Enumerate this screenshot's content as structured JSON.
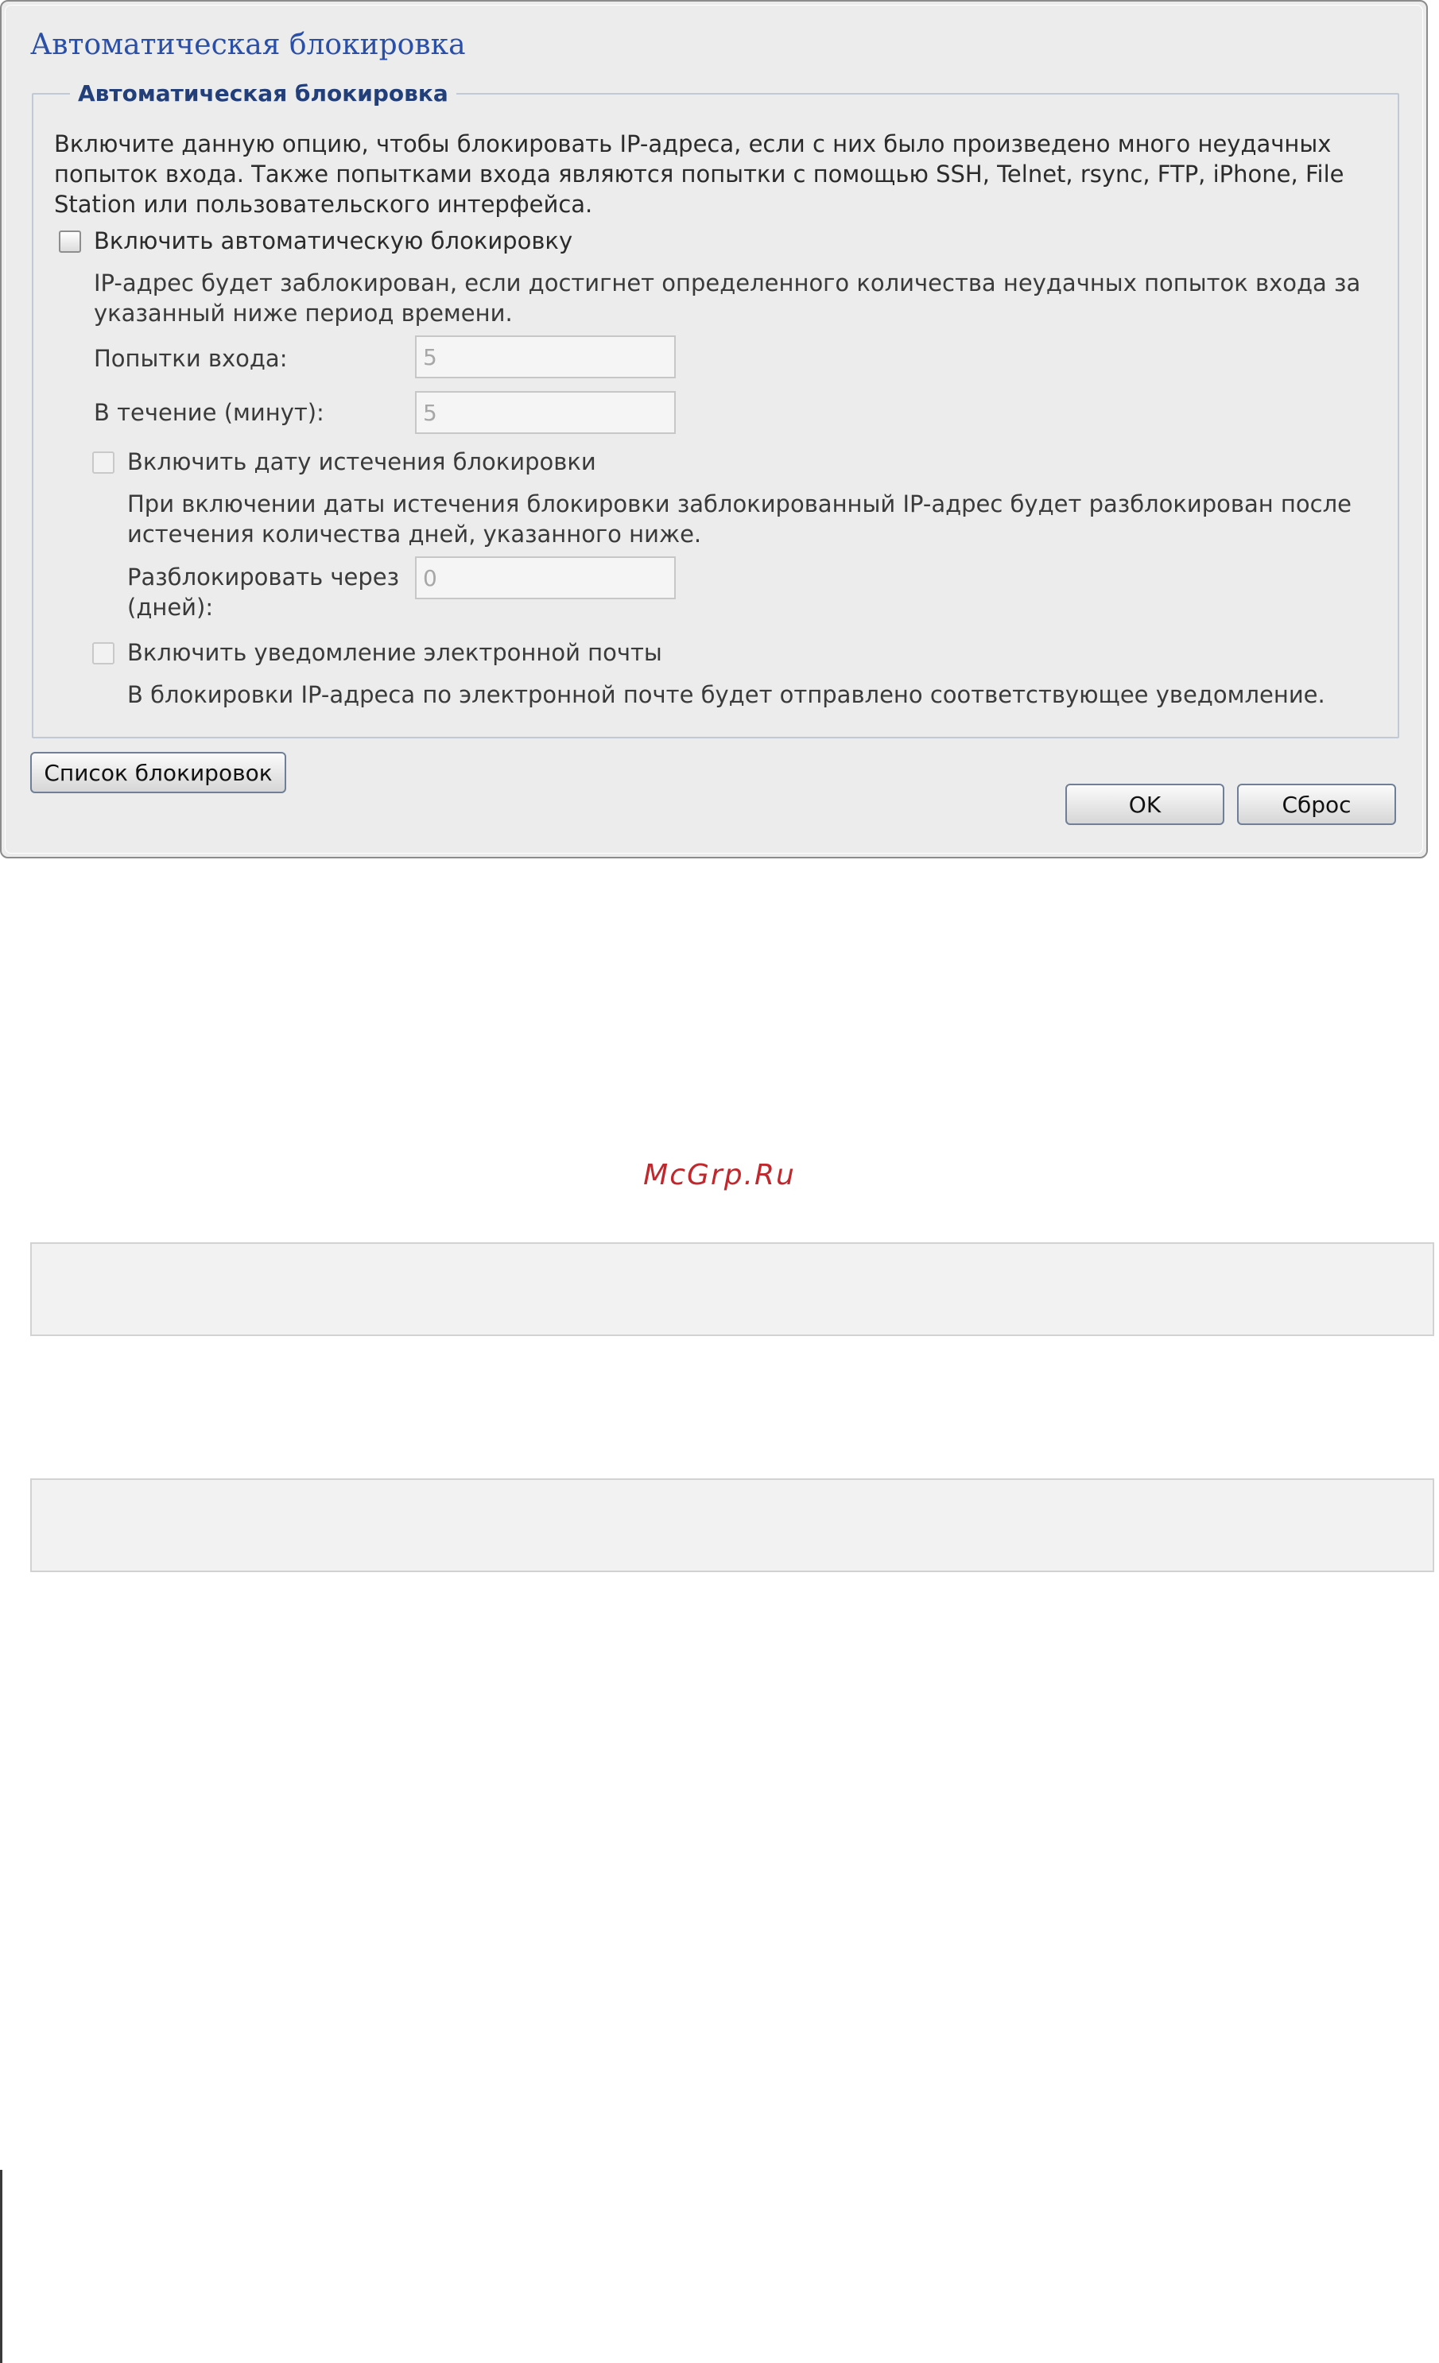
{
  "dialog": {
    "title": "Автоматическая блокировка",
    "group_title": "Автоматическая блокировка",
    "intro_line1": "Включите данную опцию, чтобы блокировать IP-адреса, если с них было произведено много неудачных",
    "intro_line2": "попыток входа. Также попытками входа являются попытки с помощью SSH, Telnet, rsync, FTP, iPhone, File",
    "intro_line3": "Station или пользовательского интерфейса.",
    "enable_auto_block": {
      "label": "Включить автоматическую блокировку",
      "checked": false
    },
    "block_desc_line1": "IP-адрес будет заблокирован, если достигнет определенного количества неудачных попыток входа за",
    "block_desc_line2": "указанный ниже период времени.",
    "login_attempts": {
      "label": "Попытки входа:",
      "value": "5"
    },
    "within_minutes": {
      "label": "В течение (минут):",
      "value": "5"
    },
    "enable_expiration": {
      "label": "Включить дату истечения блокировки",
      "checked": false
    },
    "expiration_desc_line1": "При включении даты истечения блокировки заблокированный IP-адрес будет разблокирован после",
    "expiration_desc_line2": "истечения количества дней, указанного ниже.",
    "unblock_after": {
      "label_line1": "Разблокировать через",
      "label_line2": "(дней):",
      "value": "0"
    },
    "enable_email": {
      "label": "Включить уведомление электронной почты",
      "checked": false
    },
    "email_desc": "В блокировки IP-адреса по электронной почте будет отправлено соответствующее уведомление.",
    "buttons": {
      "block_list": "Список блокировок",
      "ok": "OK",
      "reset": "Сброс"
    }
  },
  "watermark": "McGrp.Ru",
  "colors": {
    "title_blue": "#2a4fa8",
    "legend_blue": "#233f7a",
    "watermark_red": "#c0282d",
    "panel_bg": "#ececec"
  }
}
